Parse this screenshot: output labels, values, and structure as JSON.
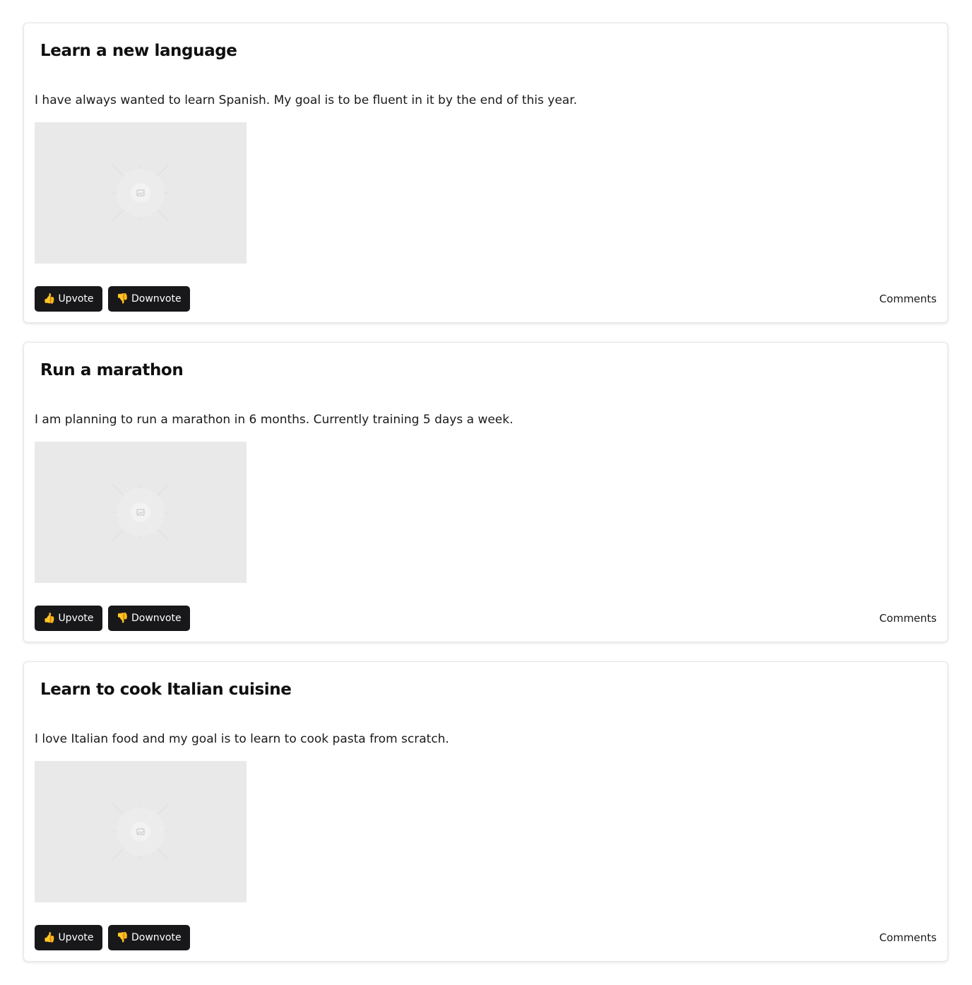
{
  "posts": [
    {
      "title": "Learn a new language",
      "body": "I have always wanted to learn Spanish. My goal is to be fluent in it by the end of this year.",
      "upvote_emoji": "👍",
      "upvote_label": "Upvote",
      "downvote_emoji": "👎",
      "downvote_label": "Downvote",
      "comments_label": "Comments"
    },
    {
      "title": "Run a marathon",
      "body": "I am planning to run a marathon in 6 months. Currently training 5 days a week.",
      "upvote_emoji": "👍",
      "upvote_label": "Upvote",
      "downvote_emoji": "👎",
      "downvote_label": "Downvote",
      "comments_label": "Comments"
    },
    {
      "title": "Learn to cook Italian cuisine",
      "body": "I love Italian food and my goal is to learn to cook pasta from scratch.",
      "upvote_emoji": "👍",
      "upvote_label": "Upvote",
      "downvote_emoji": "👎",
      "downvote_label": "Downvote",
      "comments_label": "Comments"
    }
  ],
  "colors": {
    "button_bg": "#18181a",
    "image_placeholder_bg": "#e9e9e9"
  }
}
